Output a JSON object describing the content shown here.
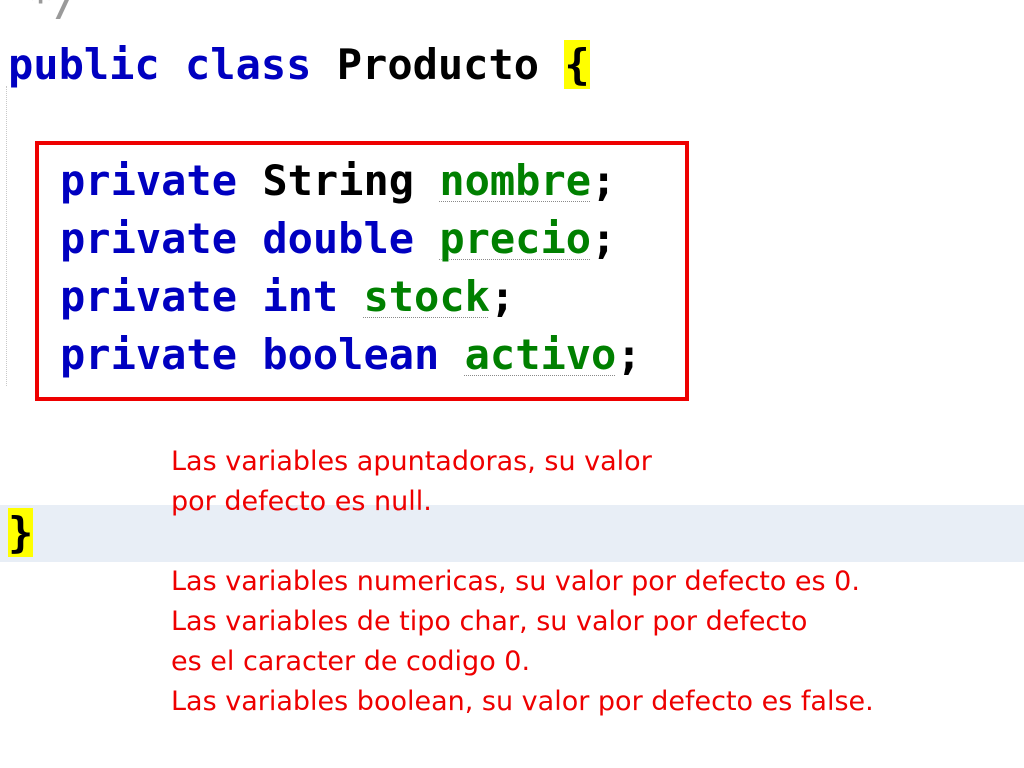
{
  "editor": {
    "comment_fragment": "*/",
    "class_line": {
      "keyword_public": "public",
      "keyword_class": "class",
      "class_name": "Producto",
      "open_brace": "{"
    },
    "fields": [
      {
        "modifier": "private",
        "type": "String",
        "name": "nombre",
        "semicolon": ";"
      },
      {
        "modifier": "private",
        "type": "double",
        "name": "precio",
        "semicolon": ";"
      },
      {
        "modifier": "private",
        "type": "int",
        "name": "stock",
        "semicolon": ";"
      },
      {
        "modifier": "private",
        "type": "boolean",
        "name": "activo",
        "semicolon": ";"
      }
    ],
    "close_brace": "}"
  },
  "annotations": {
    "pointer_note": [
      "Las variables apuntadoras, su valor",
      "por defecto es null."
    ],
    "defaults_note": [
      "Las variables numericas, su valor por defecto es 0.",
      "Las variables de tipo char, su valor por defecto",
      "es el caracter de codigo 0.",
      "Las variables boolean, su valor por defecto es false."
    ]
  },
  "colors": {
    "keyword": "#0000c0",
    "field": "#008000",
    "annotation": "#ee0000",
    "brace_highlight": "#ffff00",
    "current_line": "#e8eef6"
  }
}
